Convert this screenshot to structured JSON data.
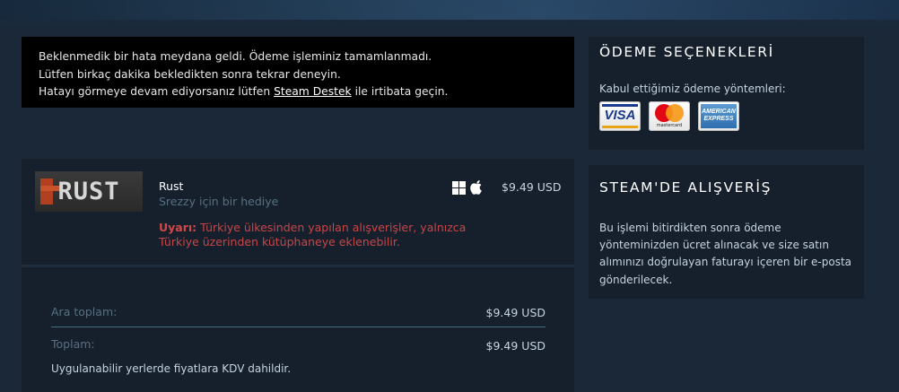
{
  "error": {
    "line1": "Beklenmedik bir hata meydana geldi. Ödeme işleminiz tamamlanmadı.",
    "line2": "Lütfen birkaç dakika bekledikten sonra tekrar deneyin.",
    "line3_before": "Hatayı görmeye devam ediyorsanız lütfen ",
    "link": "Steam Destek",
    "line3_after": " ile irtibata geçin."
  },
  "cart": {
    "item": {
      "capsule_text": "RUST",
      "title": "Rust",
      "gift_note": "Srezzy için bir hediye",
      "platforms": [
        "windows-icon",
        "apple-icon"
      ],
      "price": "$9.49 USD",
      "warning_label": "Uyarı:",
      "warning_text": " Türkiye ülkesinden yapılan alışverişler, yalnızca Türkiye üzerinden kütüphaneye eklenebilir."
    },
    "totals": {
      "subtotal_label": "Ara toplam:",
      "subtotal_value": "$9.49 USD",
      "total_label": "Toplam:",
      "total_value": "$9.49 USD",
      "vat_note": "Uygulanabilir yerlerde fiyatlara KDV dahildir."
    }
  },
  "payment_panel": {
    "title": "ÖDEME SEÇENEKLERİ",
    "accepted_label": "Kabul ettiğimiz ödeme yöntemleri:",
    "cards": {
      "visa": "VISA",
      "mastercard": "mastercard",
      "amex": "AMERICAN EXPRESS"
    }
  },
  "shop_panel": {
    "title": "STEAM'DE ALIŞVERİŞ",
    "text": "Bu işlemi bitirdikten sonra ödeme yönteminizden ücret alınacak ve size satın alımınızı doğrulayan faturayı içeren bir e-posta gönderilecek."
  },
  "colors": {
    "background": "#1b2838",
    "panel": "#16202d",
    "error_bg": "#000000",
    "warning": "#c94545"
  }
}
